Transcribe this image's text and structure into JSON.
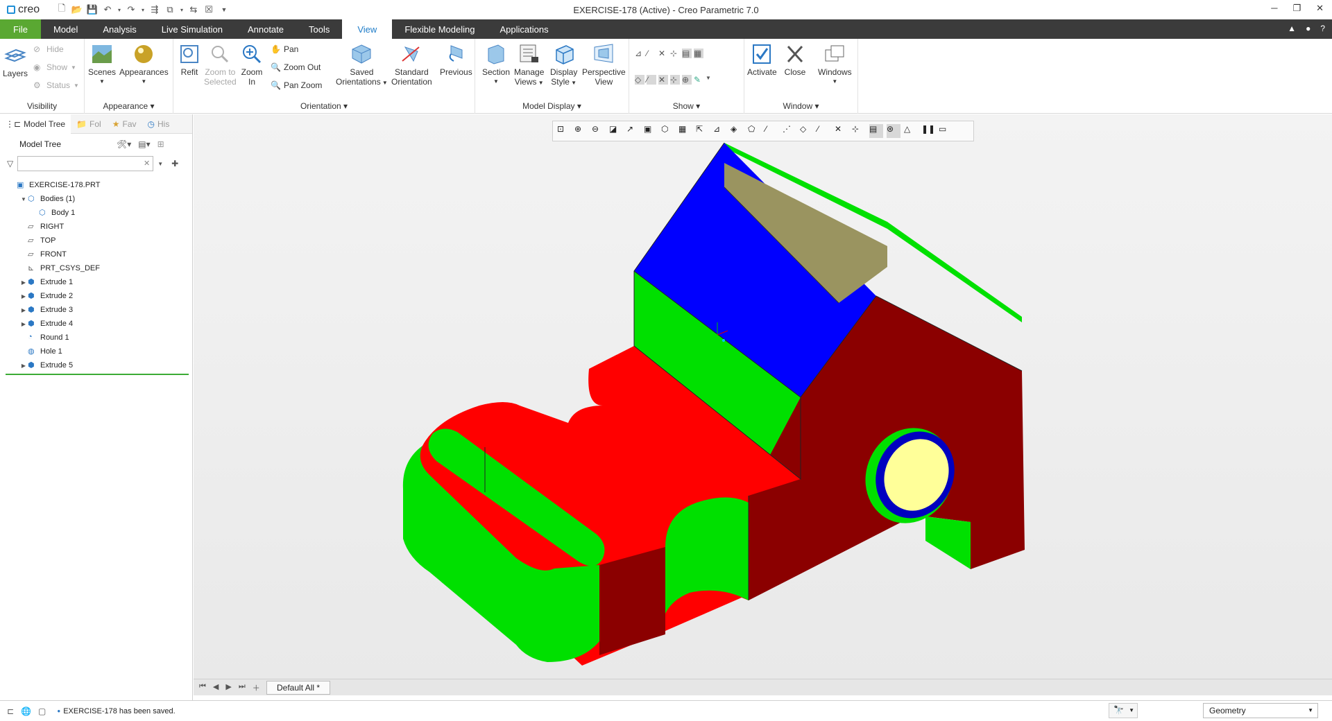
{
  "titlebar": {
    "logo": "creo",
    "window_title": "EXERCISE-178 (Active) - Creo Parametric 7.0"
  },
  "tabs": [
    "File",
    "Model",
    "Analysis",
    "Live Simulation",
    "Annotate",
    "Tools",
    "View",
    "Flexible Modeling",
    "Applications"
  ],
  "active_tab": "View",
  "ribbon": {
    "visibility": {
      "label": "Visibility",
      "layers": "Layers",
      "hide": "Hide",
      "show": "Show",
      "status": "Status"
    },
    "appearance": {
      "label": "Appearance",
      "scenes": "Scenes",
      "appearances": "Appearances"
    },
    "orientation": {
      "label": "Orientation",
      "refit": "Refit",
      "zoom_to_selected_1": "Zoom to",
      "zoom_to_selected_2": "Selected",
      "zoom_in_1": "Zoom",
      "zoom_in_2": "In",
      "pan": "Pan",
      "zoom_out": "Zoom Out",
      "pan_zoom": "Pan Zoom",
      "saved_orient_1": "Saved",
      "saved_orient_2": "Orientations",
      "std_orient_1": "Standard",
      "std_orient_2": "Orientation",
      "previous": "Previous"
    },
    "model_display": {
      "label": "Model Display",
      "section": "Section",
      "manage_views_1": "Manage",
      "manage_views_2": "Views",
      "display_style_1": "Display",
      "display_style_2": "Style",
      "perspective_1": "Perspective",
      "perspective_2": "View"
    },
    "show": {
      "label": "Show"
    },
    "window": {
      "label": "Window",
      "activate": "Activate",
      "close": "Close",
      "windows": "Windows"
    }
  },
  "left_panel": {
    "tabs": [
      "Model Tree",
      "Fol",
      "Fav",
      "His"
    ],
    "header": "Model Tree",
    "tree": [
      {
        "label": "EXERCISE-178.PRT",
        "indent": 0,
        "expander": "",
        "icon": "part-icon"
      },
      {
        "label": "Bodies (1)",
        "indent": 1,
        "expander": "▼",
        "icon": "bodies-icon"
      },
      {
        "label": "Body 1",
        "indent": 2,
        "expander": "",
        "icon": "body-icon"
      },
      {
        "label": "RIGHT",
        "indent": 1,
        "expander": "",
        "icon": "datum-plane-icon"
      },
      {
        "label": "TOP",
        "indent": 1,
        "expander": "",
        "icon": "datum-plane-icon"
      },
      {
        "label": "FRONT",
        "indent": 1,
        "expander": "",
        "icon": "datum-plane-icon"
      },
      {
        "label": "PRT_CSYS_DEF",
        "indent": 1,
        "expander": "",
        "icon": "csys-icon"
      },
      {
        "label": "Extrude 1",
        "indent": 1,
        "expander": "▶",
        "icon": "extrude-icon"
      },
      {
        "label": "Extrude 2",
        "indent": 1,
        "expander": "▶",
        "icon": "extrude-icon"
      },
      {
        "label": "Extrude 3",
        "indent": 1,
        "expander": "▶",
        "icon": "extrude-icon"
      },
      {
        "label": "Extrude 4",
        "indent": 1,
        "expander": "▶",
        "icon": "extrude-icon"
      },
      {
        "label": "Round 1",
        "indent": 1,
        "expander": "",
        "icon": "round-icon"
      },
      {
        "label": "Hole 1",
        "indent": 1,
        "expander": "",
        "icon": "hole-icon"
      },
      {
        "label": "Extrude 5",
        "indent": 1,
        "expander": "▶",
        "icon": "extrude-icon"
      }
    ]
  },
  "bottom": {
    "window_tab": "Default All *"
  },
  "status": {
    "message": "EXERCISE-178 has been saved.",
    "filter": "Geometry"
  },
  "colors": {
    "file_tab": "#5aa832",
    "tab_bar": "#3b3b3b",
    "model_red": "#ff0000",
    "model_green": "#00e000",
    "model_blue": "#0000ff",
    "model_darkred": "#8b0000",
    "model_tan": "#9a9460",
    "model_yellow": "#ffff99"
  }
}
